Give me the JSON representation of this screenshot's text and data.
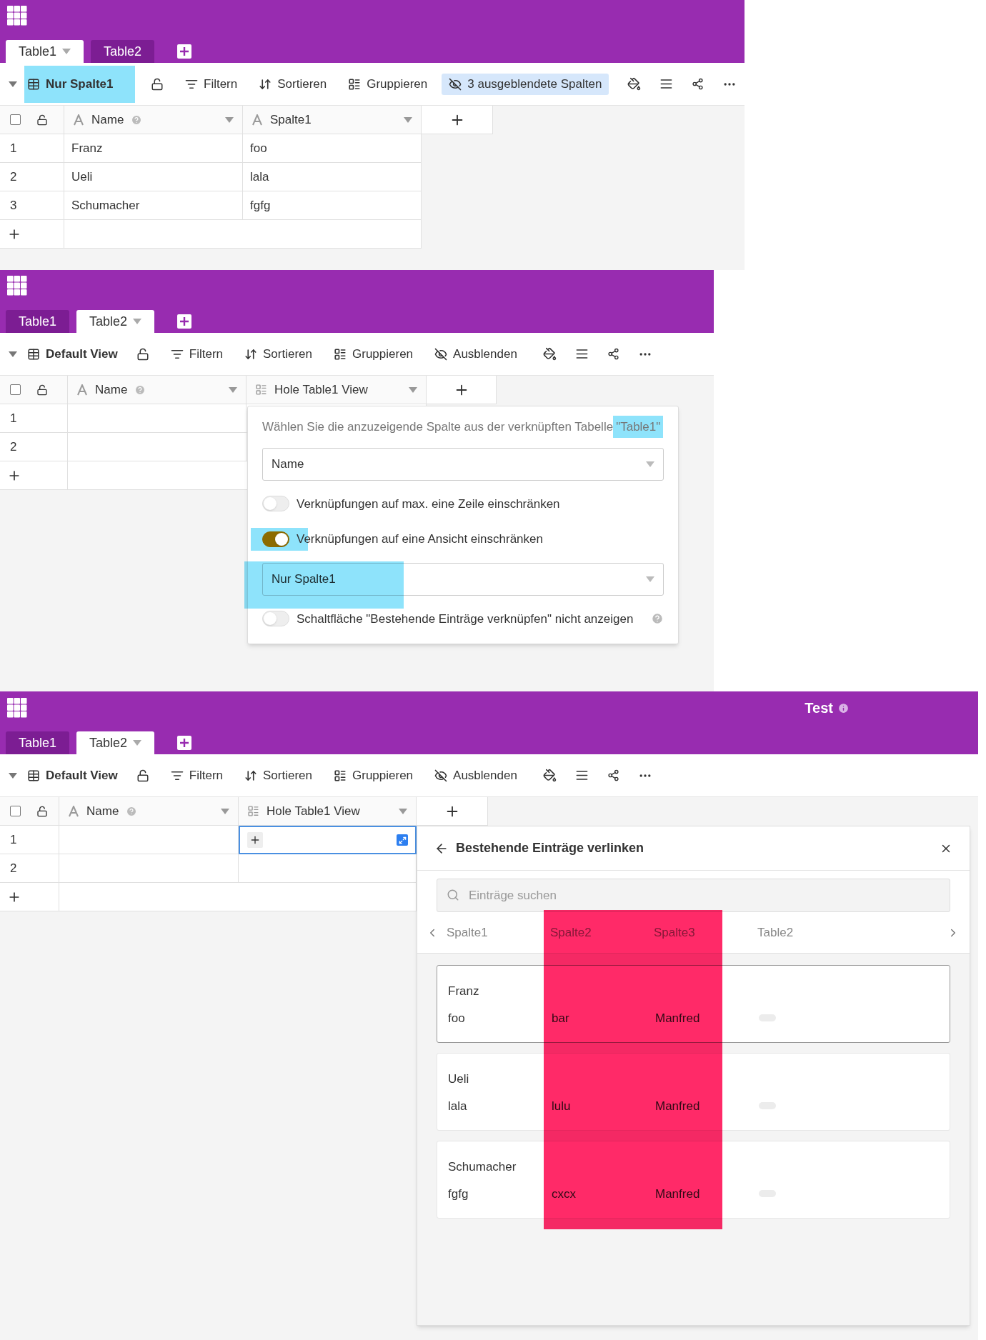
{
  "screens": [
    {
      "all_selected": false,
      "tabs": [
        {
          "label": "Table1",
          "selected": true
        },
        {
          "label": "Table2",
          "selected": false
        }
      ],
      "toolbar": {
        "view": {
          "label": "Nur Spalte1",
          "highlighted": true
        },
        "actions": [
          {
            "kind": "filter",
            "label": "Filtern",
            "active": false
          },
          {
            "kind": "sort",
            "label": "Sortieren",
            "active": false
          },
          {
            "kind": "group",
            "label": "Gruppieren",
            "active": false
          },
          {
            "kind": "hide",
            "label": "3 ausgeblendete Spalten",
            "active": true
          }
        ]
      },
      "columns": [
        {
          "name": "Name",
          "kind": "text",
          "help": true
        },
        {
          "name": "Spalte1",
          "kind": "text",
          "help": false
        }
      ],
      "rows": [
        {
          "number": "1",
          "cells": [
            {
              "value": "Franz",
              "selected": false
            },
            {
              "value": "foo",
              "selected": false
            }
          ]
        },
        {
          "number": "2",
          "cells": [
            {
              "value": "Ueli",
              "selected": false
            },
            {
              "value": "lala",
              "selected": false
            }
          ]
        },
        {
          "number": "3",
          "cells": [
            {
              "value": "Schumacher",
              "selected": false
            },
            {
              "value": "fgfg",
              "selected": false
            }
          ]
        }
      ]
    },
    {
      "all_selected": false,
      "tabs": [
        {
          "label": "Table1",
          "selected": false
        },
        {
          "label": "Table2",
          "selected": true
        }
      ],
      "toolbar": {
        "view": {
          "label": "Default View",
          "highlighted": false
        },
        "actions": [
          {
            "kind": "filter",
            "label": "Filtern",
            "active": false
          },
          {
            "kind": "sort",
            "label": "Sortieren",
            "active": false
          },
          {
            "kind": "group",
            "label": "Gruppieren",
            "active": false
          },
          {
            "kind": "hide",
            "label": "Ausblenden",
            "active": false
          }
        ]
      },
      "columns": [
        {
          "name": "Name",
          "kind": "text",
          "help": true
        },
        {
          "name": "Hole Table1 View",
          "kind": "link",
          "help": false
        }
      ],
      "rows": [
        {
          "number": "1",
          "cells": [
            {
              "selected": false
            },
            {
              "selected": false
            }
          ]
        },
        {
          "number": "2",
          "cells": [
            {
              "selected": false
            },
            {
              "selected": false
            }
          ]
        }
      ],
      "link_settings": {
        "description": "Wählen Sie die anzuzeigende Spalte aus der verknüpften Tabelle",
        "table_ref": {
          "text": "\"Table1\"",
          "highlighted": true
        },
        "options": [
          {
            "kind": "select",
            "value": "Name",
            "highlighted": false
          },
          {
            "kind": "toggle",
            "label": "Verknüpfungen auf max. eine Zeile einschränken",
            "on": false,
            "highlighted": false,
            "help": false
          },
          {
            "kind": "toggle",
            "label": "Verknüpfungen auf eine Ansicht einschränken",
            "on": true,
            "highlighted": true,
            "help": false
          },
          {
            "kind": "select",
            "value": "Nur Spalte1",
            "highlighted": true
          },
          {
            "kind": "toggle",
            "label": "Schaltfläche \"Bestehende Einträge verknüpfen\" nicht anzeigen",
            "on": false,
            "highlighted": false,
            "help": true
          }
        ]
      }
    },
    {
      "title": "Test",
      "all_selected": false,
      "tabs": [
        {
          "label": "Table1",
          "selected": false
        },
        {
          "label": "Table2",
          "selected": true
        }
      ],
      "toolbar": {
        "view": {
          "label": "Default View",
          "highlighted": false
        },
        "actions": [
          {
            "kind": "filter",
            "label": "Filtern",
            "active": false
          },
          {
            "kind": "sort",
            "label": "Sortieren",
            "active": false
          },
          {
            "kind": "group",
            "label": "Gruppieren",
            "active": false
          },
          {
            "kind": "hide",
            "label": "Ausblenden",
            "active": false
          }
        ]
      },
      "columns": [
        {
          "name": "Name",
          "kind": "text",
          "help": true
        },
        {
          "name": "Hole Table1 View",
          "kind": "link",
          "help": false
        }
      ],
      "rows": [
        {
          "number": "1",
          "cells": [
            {
              "selected": false
            },
            {
              "selected": true
            }
          ]
        },
        {
          "number": "2",
          "cells": [
            {
              "selected": false
            },
            {
              "selected": false
            }
          ]
        }
      ],
      "link_drawer": {
        "title": "Bestehende Einträge verlinken",
        "search": {
          "placeholder": "Einträge suchen"
        },
        "columns": [
          {
            "name": "Spalte1",
            "highlighted": false
          },
          {
            "name": "Spalte2",
            "highlighted": true
          },
          {
            "name": "Spalte3",
            "highlighted": true
          },
          {
            "name": "Table2",
            "highlighted": false
          }
        ],
        "records": [
          {
            "title": "Franz",
            "selected": true,
            "values": [
              "foo",
              "bar",
              "Manfred"
            ]
          },
          {
            "title": "Ueli",
            "selected": false,
            "values": [
              "lala",
              "lulu",
              "Manfred"
            ]
          },
          {
            "title": "Schumacher",
            "selected": false,
            "values": [
              "fgfg",
              "cxcx",
              "Manfred"
            ]
          }
        ]
      }
    }
  ]
}
